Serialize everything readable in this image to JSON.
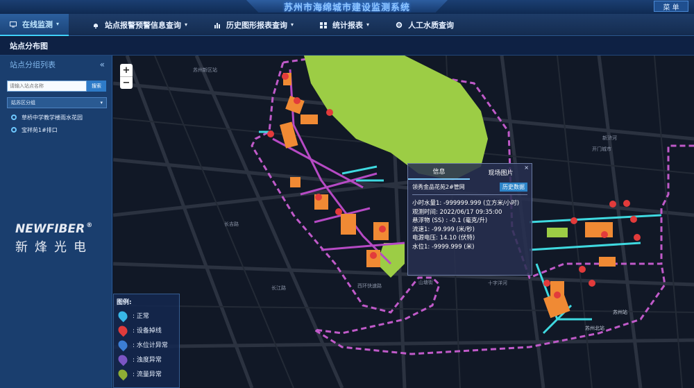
{
  "app": {
    "title": "苏州市海绵城市建设监测系统",
    "menu_label": "菜 单"
  },
  "nav": {
    "items": [
      {
        "label": "在线监测",
        "icon": "monitor-icon",
        "caret": "▾"
      },
      {
        "label": "站点报警预警信息查询",
        "icon": "bell-icon",
        "caret": "▾"
      },
      {
        "label": "历史图形报表查询",
        "icon": "bar-chart-icon",
        "caret": "▾"
      },
      {
        "label": "统计报表",
        "icon": "grid-icon",
        "caret": "▾"
      },
      {
        "label": "人工水质查询",
        "icon": "gear-icon",
        "caret": ""
      }
    ]
  },
  "page": {
    "title": "站点分布图"
  },
  "sidebar": {
    "heading": "站点分组列表",
    "collapse_glyph": "«",
    "search_placeholder": "请输入站点名称",
    "search_button": "搜索",
    "district_label": "姑苏区分组",
    "district_caret": "▾",
    "sites": [
      {
        "name": "草桥中学教学楼雨水花园"
      },
      {
        "name": "宝祥苑1#排口"
      }
    ]
  },
  "logo": {
    "en": "NEWFIBER",
    "mark": "®",
    "cn": "新烽光电"
  },
  "map": {
    "zoom_in": "+",
    "zoom_out": "−",
    "labels": [
      {
        "text": "苏州新区站"
      },
      {
        "text": "长江路"
      },
      {
        "text": "长吉路"
      },
      {
        "text": "西环快速路"
      },
      {
        "text": "山塘街"
      },
      {
        "text": "十字洋河"
      },
      {
        "text": "苏州站"
      },
      {
        "text": "苏州北站"
      },
      {
        "text": "开门城市"
      },
      {
        "text": "新浒河"
      }
    ]
  },
  "legend": {
    "title": "图例:",
    "items": [
      {
        "label": ": 正常",
        "color": "#38b7e8",
        "icon": "pin-normal-icon"
      },
      {
        "label": ": 设备掉线",
        "color": "#e03b3b",
        "icon": "pin-offline-icon"
      },
      {
        "label": ": 水位计异常",
        "color": "#3c7ed4",
        "icon": "pin-water-level-icon"
      },
      {
        "label": ": 浊度异常",
        "color": "#7b55c4",
        "icon": "pin-turbidity-icon"
      },
      {
        "label": ": 流量异常",
        "color": "#8fae35",
        "icon": "pin-flow-icon"
      }
    ]
  },
  "popup": {
    "close": "×",
    "tabs": [
      "信息",
      "现场图片"
    ],
    "site_name": "领秀金品花苑2#管网",
    "history_button": "历史数据",
    "lines": [
      "小时水量1: -999999.999 (立方米/小时)",
      "观测时间: 2022/06/17 09:35:00",
      "悬浮物 (SS) : -0.1 (毫克/升)",
      "流速1: -99.999 (米/秒)",
      "电源电压: 14.10 (伏特)",
      "水位1: -9999.999 (米)"
    ]
  },
  "colors": {
    "district_boundary": "#c05ac9",
    "green_area": "#9ccd45",
    "building": "#f08a34",
    "pipe": "#3fd9e0",
    "marker": "#e23b3b"
  }
}
